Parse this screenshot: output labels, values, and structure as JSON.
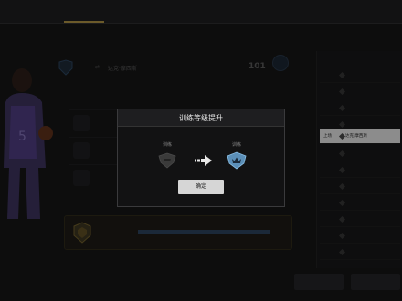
{
  "modal": {
    "title": "训练等级提升",
    "from_level_label": "训练",
    "to_level_label": "训练",
    "confirm_label": "确定"
  },
  "player": {
    "name": "达克·摩西斯",
    "level": "101",
    "jersey_number": "5"
  },
  "roster": {
    "selected_position": "上场",
    "selected_name": "达克·摩西斯"
  },
  "colors": {
    "modal_bg": "#121213",
    "modal_border": "#3a3a3c",
    "confirm_bg": "#d6d6d6",
    "to_icon": "#5b8fb8",
    "from_icon": "#3a3a3a",
    "jersey": "#4a3a7a"
  },
  "icons": {
    "from": "rank-shield-dark-icon",
    "to": "rank-shield-blue-crown-icon",
    "arrow": "right-arrow-icon"
  }
}
